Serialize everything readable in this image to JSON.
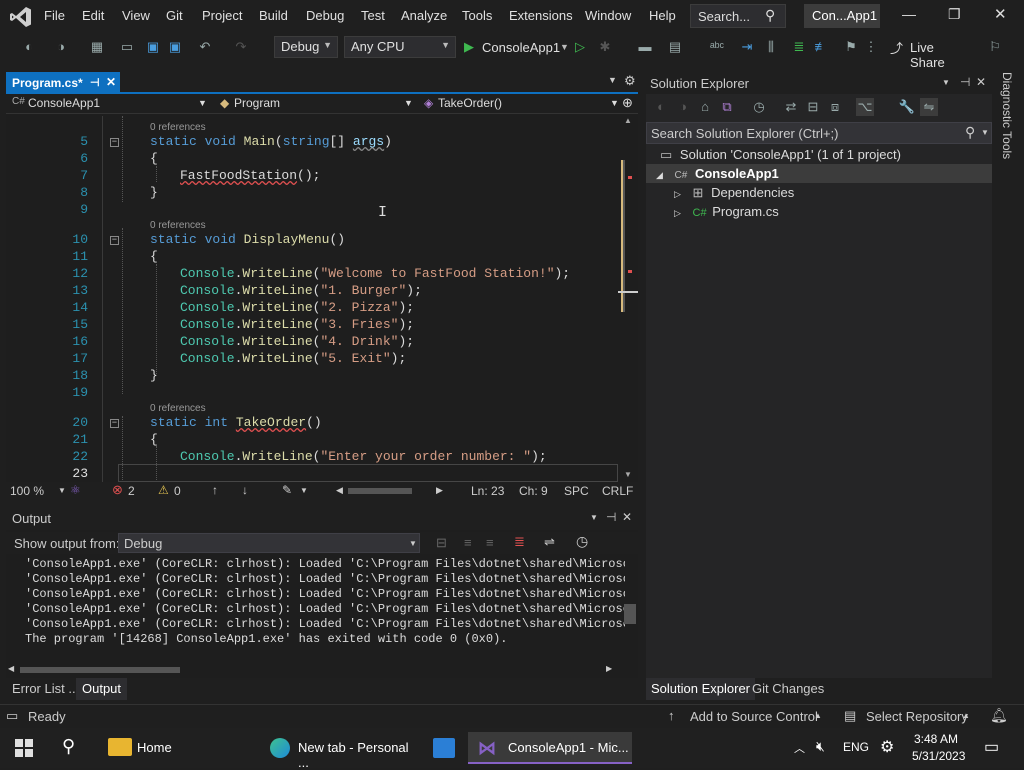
{
  "menu": [
    "File",
    "Edit",
    "View",
    "Git",
    "Project",
    "Build",
    "Debug",
    "Test",
    "Analyze",
    "Tools",
    "Extensions",
    "Window",
    "Help"
  ],
  "search_label": "Search...",
  "solution_name_short": "Con...App1",
  "toolbar": {
    "config": "Debug",
    "platform": "Any CPU",
    "start_target": "ConsoleApp1",
    "live_share": "Live Share"
  },
  "editor": {
    "tab_title": "Program.cs*",
    "nav_project": "ConsoleApp1",
    "nav_class": "Program",
    "nav_member": "TakeOrder()",
    "codelens": "0 references",
    "lines": [
      {
        "n": "5",
        "type": "main"
      },
      {
        "n": "6",
        "text": "{"
      },
      {
        "n": "7",
        "type": "call"
      },
      {
        "n": "8",
        "text": "}"
      },
      {
        "n": "9"
      },
      {
        "n": "10",
        "type": "displaymenu"
      },
      {
        "n": "11",
        "text": "{"
      },
      {
        "n": "12",
        "str": "\"Welcome to FastFood Station!\""
      },
      {
        "n": "13",
        "str": "\"1. Burger\""
      },
      {
        "n": "14",
        "str": "\"2. Pizza\""
      },
      {
        "n": "15",
        "str": "\"3. Fries\""
      },
      {
        "n": "16",
        "str": "\"4. Drink\""
      },
      {
        "n": "17",
        "str": "\"5. Exit\""
      },
      {
        "n": "18",
        "text": "}"
      },
      {
        "n": "19"
      },
      {
        "n": "20",
        "type": "takeorder"
      },
      {
        "n": "21",
        "text": "{"
      },
      {
        "n": "22",
        "str": "\"Enter your order number: \""
      },
      {
        "n": "23"
      }
    ],
    "code_tokens": {
      "static": "static",
      "void": "void",
      "int": "int",
      "string": "string",
      "main": "Main",
      "args": "args",
      "fastfood": "FastFoodStation",
      "displaymenu": "DisplayMenu",
      "takeorder": "TakeOrder",
      "console": "Console",
      "writeline": "WriteLine",
      "main_params_open": "(",
      "main_params_close": "[] ",
      "paren_close": ")",
      "call_tail": "();",
      "empty_parens": "()",
      "arg_close": ");",
      "dot": "."
    },
    "status": {
      "zoom": "100 %",
      "errors": "2",
      "warnings": "0",
      "line": "Ln: 23",
      "col": "Ch: 9",
      "spacing": "SPC",
      "eol": "CRLF"
    }
  },
  "output": {
    "title": "Output",
    "show_from_label": "Show output from:",
    "source": "Debug",
    "lines": [
      "'ConsoleApp1.exe' (CoreCLR: clrhost): Loaded 'C:\\Program Files\\dotnet\\shared\\Microsoft",
      "'ConsoleApp1.exe' (CoreCLR: clrhost): Loaded 'C:\\Program Files\\dotnet\\shared\\Microsoft",
      "'ConsoleApp1.exe' (CoreCLR: clrhost): Loaded 'C:\\Program Files\\dotnet\\shared\\Microsoft",
      "'ConsoleApp1.exe' (CoreCLR: clrhost): Loaded 'C:\\Program Files\\dotnet\\shared\\Microsoft",
      "'ConsoleApp1.exe' (CoreCLR: clrhost): Loaded 'C:\\Program Files\\dotnet\\shared\\Microsoft",
      "The program '[14268] ConsoleApp1.exe' has exited with code 0 (0x0)."
    ]
  },
  "bottom_tabs": [
    "Error List ...",
    "Output"
  ],
  "solution_explorer": {
    "title": "Solution Explorer",
    "search_placeholder": "Search Solution Explorer (Ctrl+;)",
    "solution": "Solution 'ConsoleApp1' (1 of 1 project)",
    "project": "ConsoleApp1",
    "dependencies": "Dependencies",
    "file": "Program.cs",
    "tabs": [
      "Solution Explorer",
      "Git Changes"
    ]
  },
  "diagnostic_tools": "Diagnostic Tools",
  "statusbar": {
    "ready": "Ready",
    "source_control": "Add to Source Control",
    "repository": "Select Repository"
  },
  "taskbar": {
    "apps": [
      "Home",
      "New tab - Personal ...",
      "ConsoleApp1 - Mic..."
    ],
    "lang": "ENG",
    "time": "3:48 AM",
    "date": "5/31/2023"
  },
  "colors": {
    "accent": "#0e70c0",
    "vs_purple": "#8661c5",
    "error": "#e05050"
  }
}
